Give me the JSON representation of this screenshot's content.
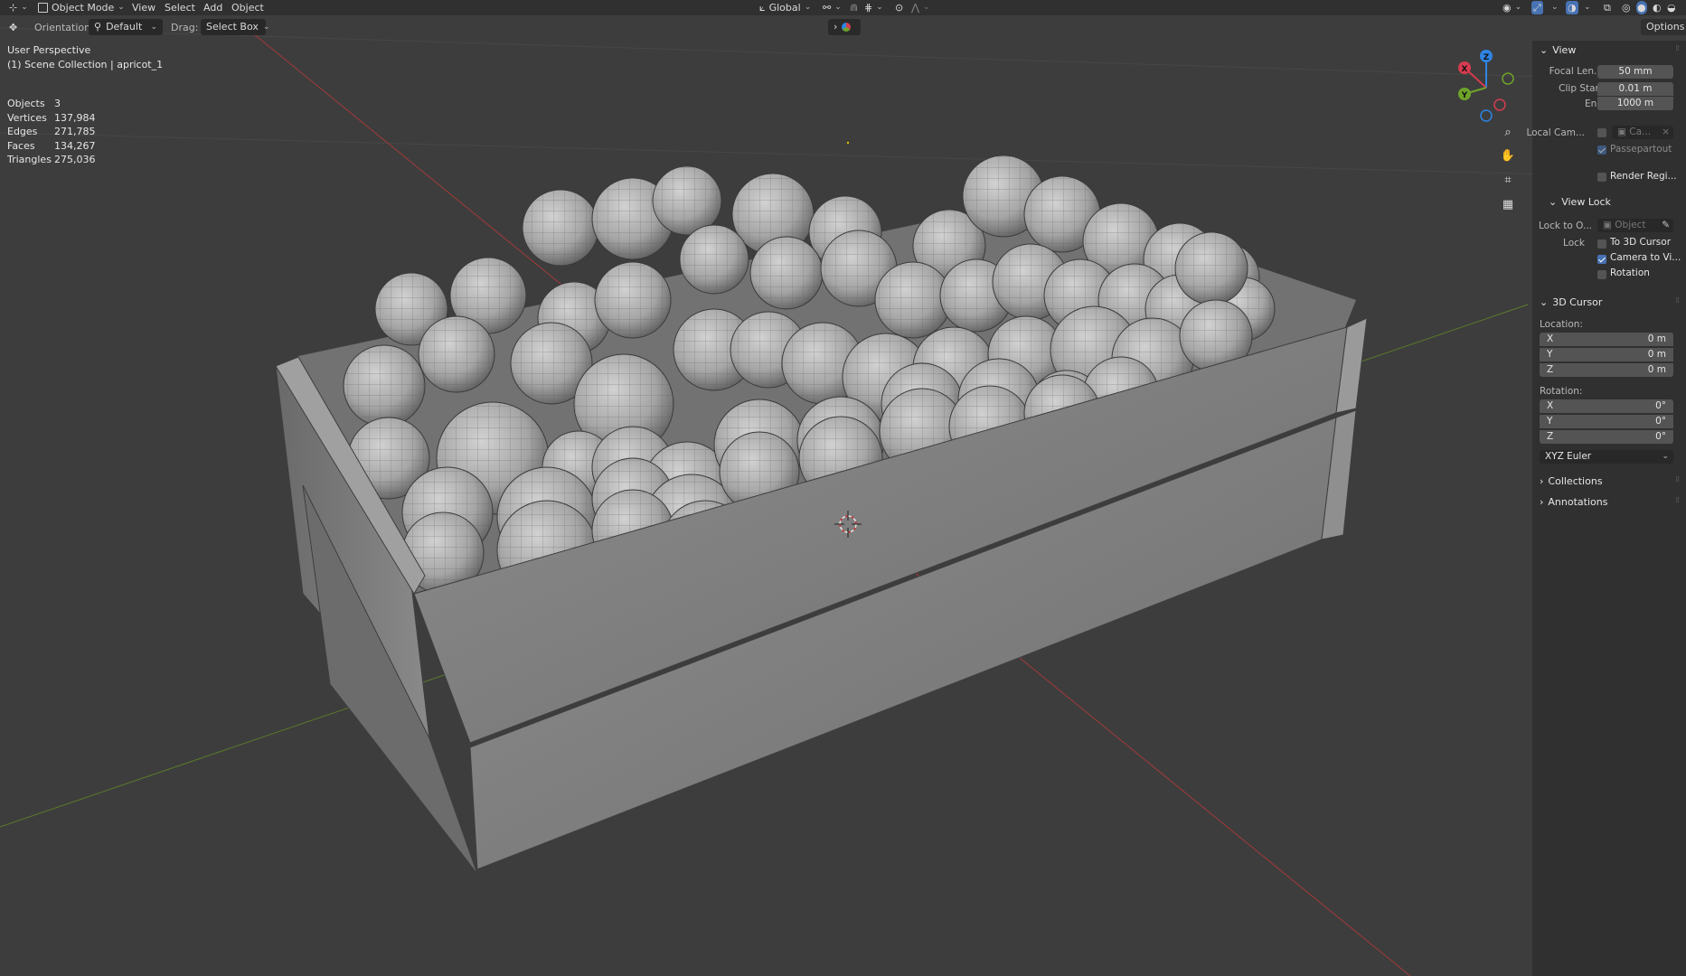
{
  "header": {
    "mode": "Object Mode",
    "menus": [
      "View",
      "Select",
      "Add",
      "Object"
    ],
    "transform_orientation": "Global",
    "options_label": "Options"
  },
  "tool_settings": {
    "orientation_label": "Orientation:",
    "orientation_value": "Default",
    "drag_label": "Drag:",
    "drag_value": "Select Box"
  },
  "viewport": {
    "view_name": "User Perspective",
    "collection": "(1) Scene Collection | apricot_1",
    "stats": [
      {
        "label": "Objects",
        "value": "3"
      },
      {
        "label": "Vertices",
        "value": "137,984"
      },
      {
        "label": "Edges",
        "value": "271,785"
      },
      {
        "label": "Faces",
        "value": "134,267"
      },
      {
        "label": "Triangles",
        "value": "275,036"
      }
    ],
    "gizmo_axes": {
      "x": "X",
      "y": "Y",
      "z": "Z"
    }
  },
  "sidebar": {
    "view_section": {
      "title": "View",
      "focal_length_label": "Focal Len...",
      "focal_length_value": "50 mm",
      "clip_start_label": "Clip Start",
      "clip_start_value": "0.01 m",
      "clip_end_label": "End",
      "clip_end_value": "1000 m",
      "local_camera_label": "Local Cam...",
      "local_camera_value": "Ca...",
      "passepartout_label": "Passepartout",
      "render_region_label": "Render Regi..."
    },
    "view_lock": {
      "title": "View Lock",
      "lock_to_object_label": "Lock to O...",
      "lock_to_object_value": "Object",
      "lock_label": "Lock",
      "to_3d_cursor_label": "To 3D Cursor",
      "camera_to_view_label": "Camera to Vi...",
      "rotation_label": "Rotation"
    },
    "cursor_3d": {
      "title": "3D Cursor",
      "location_label": "Location:",
      "location": [
        {
          "axis": "X",
          "value": "0 m"
        },
        {
          "axis": "Y",
          "value": "0 m"
        },
        {
          "axis": "Z",
          "value": "0 m"
        }
      ],
      "rotation_label": "Rotation:",
      "rotation": [
        {
          "axis": "X",
          "value": "0°"
        },
        {
          "axis": "Y",
          "value": "0°"
        },
        {
          "axis": "Z",
          "value": "0°"
        }
      ],
      "rotation_mode": "XYZ Euler"
    },
    "collections_title": "Collections",
    "annotations_title": "Annotations"
  },
  "colors": {
    "viewport_bg": "#3d3d3d",
    "panel_bg": "#303030",
    "field_bg": "#545454",
    "accent_blue": "#4772b3",
    "axis_x": "#d63b4f",
    "axis_y": "#6ea42a",
    "axis_z": "#2f84e3"
  }
}
